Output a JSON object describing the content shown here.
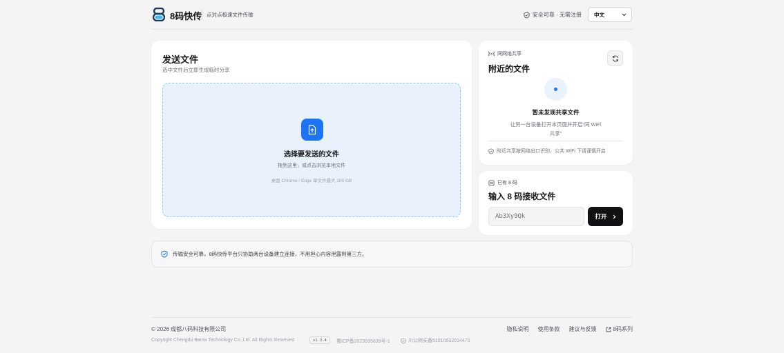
{
  "header": {
    "brand": "8码快传",
    "tagline": "点对点极速文件传输",
    "secure_text": "安全可靠 · 无需注册",
    "language": "中文",
    "language_options": [
      "中文"
    ]
  },
  "send": {
    "title": "发送文件",
    "subtitle": "选中文件后立即生成临时分享",
    "drop_title": "选择要发送的文件",
    "drop_subtitle": "拖到这里，或点击浏览本地文件",
    "drop_note": "桌面 Chrome / Edge 单文件最大 100 GB"
  },
  "nearby": {
    "tag": "同网络共享",
    "title": "附近的文件",
    "empty_title": "暂未发现共享文件",
    "empty_hint": "让另一台设备打开本页面并开启“同 WiFi 共享”",
    "footer": "附近共享按网络出口识别，公共 WiFi 下请谨慎开启"
  },
  "receive": {
    "tag": "已有 8 码",
    "title": "输入 8 码接收文件",
    "input_placeholder": "Ab3Xy9Qk",
    "open_label": "打开"
  },
  "notice": {
    "text": "传输安全可靠，8码快传平台只协助两台设备建立连接，不用担心内容泄露到第三方。"
  },
  "footer": {
    "copyright": "© 2026 成都八码科技有限公司",
    "copyright_en": "Copyright Chengdu Bama Technology Co.,Ltd. All Rights Reserved",
    "version": "v1.3.4",
    "icp": "蜀ICP备2023035828号-1",
    "police": "川公网安备51010502014475",
    "links": [
      "隐私说明",
      "使用条款",
      "建议与反馈",
      "8码系列"
    ]
  },
  "colors": {
    "accent": "#1d74f5",
    "drop_bg": "#e8f1fc",
    "button_dark": "#111113"
  }
}
